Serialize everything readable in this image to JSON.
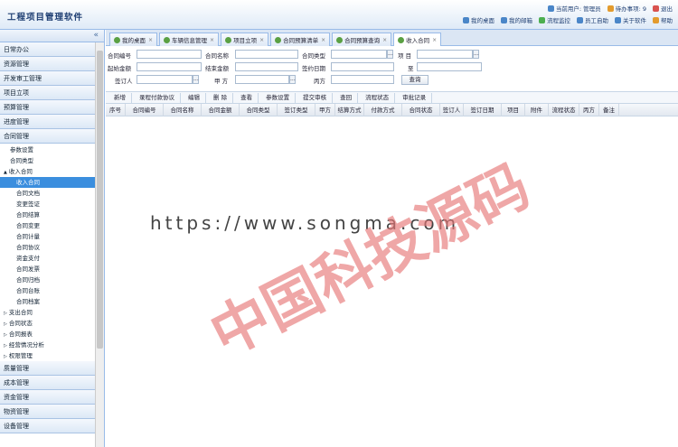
{
  "app_title": "工程项目管理软件",
  "header": {
    "row1": [
      {
        "icon": "user-icon",
        "label": "当前用户: 管理员"
      },
      {
        "icon": "task-icon",
        "label": "待办事项: 9"
      },
      {
        "icon": "exit-icon",
        "label": "退出"
      }
    ],
    "row2": [
      {
        "icon": "home-icon",
        "label": "我的桌面"
      },
      {
        "icon": "mail-icon",
        "label": "我的邮箱"
      },
      {
        "icon": "flow-icon",
        "label": "流程监控"
      },
      {
        "icon": "person-icon",
        "label": "员工自助"
      },
      {
        "icon": "info-icon",
        "label": "关于软件"
      },
      {
        "icon": "help-icon",
        "label": "帮助"
      }
    ]
  },
  "sidebar": {
    "collapse": "«",
    "sections_top": [
      "日常办公",
      "资源管理",
      "开发审工管理",
      "项目立项",
      "预算管理",
      "进度管理",
      "合同管理"
    ],
    "tree": [
      {
        "label": "参数设置",
        "indent": 1
      },
      {
        "label": "合同类型",
        "indent": 1
      },
      {
        "label": "收入合同",
        "indent": 0,
        "expander": "▲"
      },
      {
        "label": "收入合同",
        "indent": 2,
        "selected": true
      },
      {
        "label": "合同文档",
        "indent": 2
      },
      {
        "label": "变更签证",
        "indent": 2
      },
      {
        "label": "合同结算",
        "indent": 2
      },
      {
        "label": "合同变更",
        "indent": 2
      },
      {
        "label": "合同计量",
        "indent": 2
      },
      {
        "label": "合同协议",
        "indent": 2
      },
      {
        "label": "资金支付",
        "indent": 2
      },
      {
        "label": "合同发票",
        "indent": 2
      },
      {
        "label": "合同归档",
        "indent": 2
      },
      {
        "label": "合同台账",
        "indent": 2
      },
      {
        "label": "合同档案",
        "indent": 2
      },
      {
        "label": "支出合同",
        "indent": 0,
        "expander": "▷"
      },
      {
        "label": "合同状态",
        "indent": 0,
        "expander": "▷"
      },
      {
        "label": "合同报表",
        "indent": 0,
        "expander": "▷"
      },
      {
        "label": "经营情况分析",
        "indent": 0,
        "expander": "▷"
      },
      {
        "label": "权限管理",
        "indent": 0,
        "expander": "▷"
      }
    ],
    "sections_bottom": [
      "质量管理",
      "成本管理",
      "资金管理",
      "物资管理",
      "设备管理"
    ]
  },
  "tabs": [
    "我的桌面",
    "车辆信息管理",
    "项目立项",
    "合同预算清单",
    "合同预算查询",
    "收入合同"
  ],
  "form": {
    "labels": [
      "合同编号",
      "合同名称",
      "合同类型",
      "项 目",
      "起始金额",
      "结束金额",
      "签约日期",
      "至",
      "签订人",
      "甲 方",
      "丙方"
    ],
    "query": "查询"
  },
  "toolbar": [
    "新增",
    "录程付款协议",
    "编辑",
    "删 除",
    "查看",
    "参数设置",
    "提交审核",
    "查回",
    "流程状态",
    "审批记录"
  ],
  "columns": [
    "序号",
    "合同编号",
    "合同名称",
    "合同金额",
    "合同类型",
    "签订类型",
    "甲方",
    "结算方式",
    "付款方式",
    "合同状态",
    "签订人",
    "签订日期",
    "项目",
    "附件",
    "流程状态",
    "丙方",
    "备注"
  ],
  "watermark": {
    "url": "https://www.songma.com",
    "cn": "中国科技源码"
  }
}
